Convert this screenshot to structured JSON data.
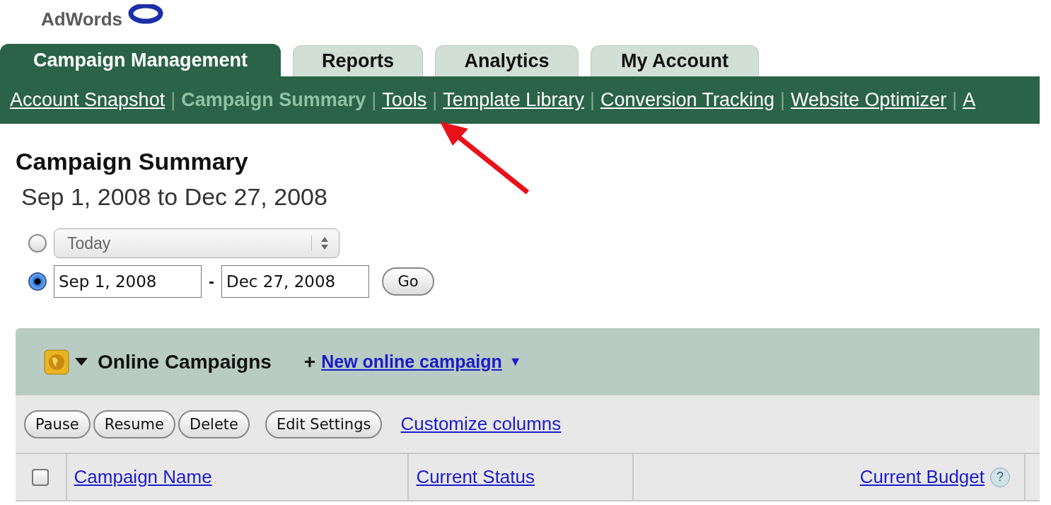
{
  "logo": {
    "text": "AdWords"
  },
  "tabs": [
    {
      "label": "Campaign Management",
      "selected": true
    },
    {
      "label": "Reports",
      "selected": false
    },
    {
      "label": "Analytics",
      "selected": false
    },
    {
      "label": "My Account",
      "selected": false
    }
  ],
  "subnav": {
    "separator": "|",
    "items": [
      {
        "label": "Account Snapshot",
        "selected": false
      },
      {
        "label": "Campaign Summary",
        "selected": true
      },
      {
        "label": "Tools",
        "selected": false
      },
      {
        "label": "Template Library",
        "selected": false
      },
      {
        "label": "Conversion Tracking",
        "selected": false
      },
      {
        "label": "Website Optimizer",
        "selected": false
      },
      {
        "label": "A",
        "selected": false
      }
    ]
  },
  "page_title": "Campaign Summary",
  "date_range": "Sep 1, 2008 to Dec 27, 2008",
  "date_options": [
    {
      "kind": "preset",
      "selected": false,
      "value": "Today"
    },
    {
      "kind": "custom",
      "selected": true,
      "start": "Sep 1, 2008",
      "dash": "-",
      "end": "Dec 27, 2008",
      "go": "Go"
    }
  ],
  "panel": {
    "title": "Online Campaigns",
    "new_link": {
      "prefix": "+",
      "label": "New online campaign",
      "caret": "▼"
    },
    "toolbar": {
      "buttons": [
        "Pause",
        "Resume",
        "Delete",
        "Edit Settings"
      ],
      "link": "Customize columns"
    },
    "table": {
      "columns": [
        {
          "kind": "checkbox",
          "checked": false
        },
        {
          "kind": "link",
          "label": "Campaign Name"
        },
        {
          "kind": "link",
          "label": "Current Status"
        },
        {
          "kind": "link",
          "label": "Current Budget",
          "help": "?"
        }
      ]
    }
  }
}
